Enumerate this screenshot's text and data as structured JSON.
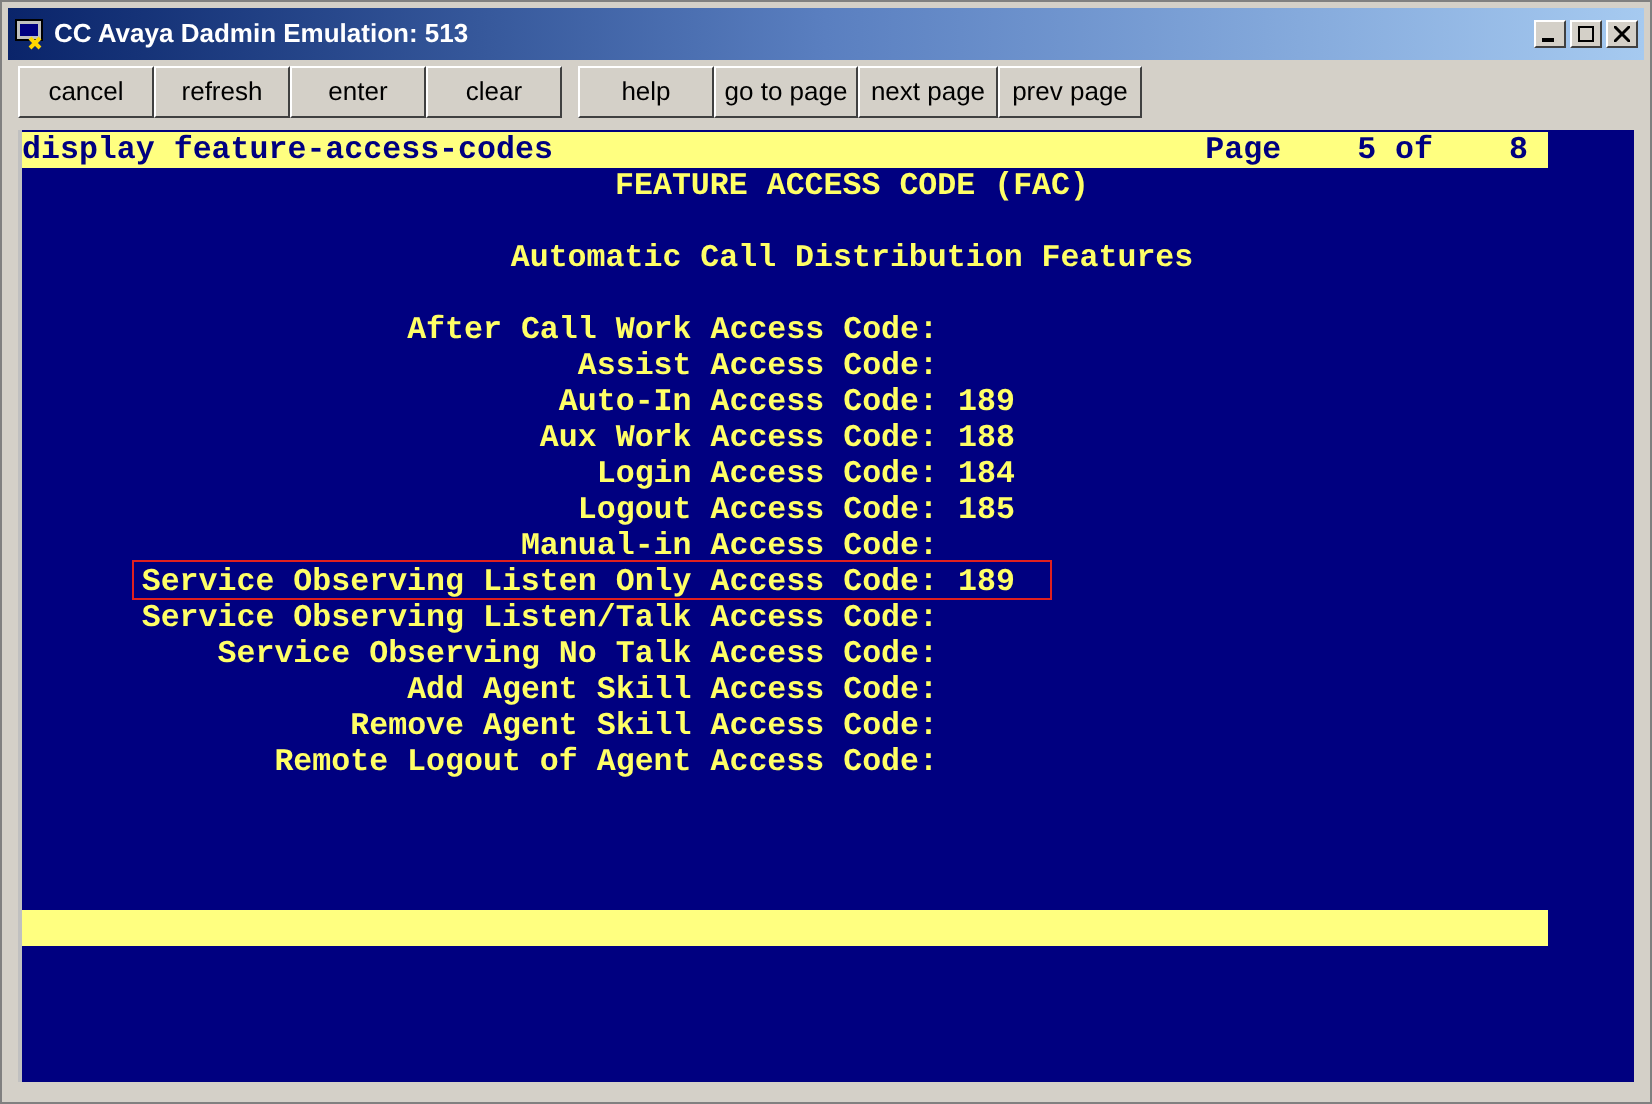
{
  "window": {
    "title": "CC Avaya Dadmin Emulation: 513"
  },
  "toolbar": [
    "cancel",
    "refresh",
    "enter",
    "clear",
    "help",
    "go to page",
    "next page",
    "prev page"
  ],
  "terminal": {
    "command": "display feature-access-codes",
    "page_label": "Page",
    "page": "5",
    "of_label": "of",
    "pages": "8",
    "title": "FEATURE ACCESS CODE (FAC)",
    "section": "Automatic Call Distribution Features",
    "fields": [
      {
        "label": "After Call Work Access Code:",
        "highlighted": false
      },
      {
        "label": "Assist Access Code:",
        "highlighted": false
      },
      {
        "label": "Auto-In Access Code:",
        "value": "189",
        "highlighted": false
      },
      {
        "label": "Aux Work Access Code:",
        "value": "188",
        "highlighted": false
      },
      {
        "label": "Login Access Code:",
        "value": "184",
        "highlighted": false
      },
      {
        "label": "Logout Access Code:",
        "value": "185",
        "highlighted": false
      },
      {
        "label": "Manual-in Access Code:",
        "highlighted": false
      },
      {
        "label": "Service Observing Listen Only Access Code:",
        "value": "189",
        "highlighted": true
      },
      {
        "label": "Service Observing Listen/Talk Access Code:",
        "highlighted": false
      },
      {
        "label": "Service Observing No Talk Access Code:",
        "highlighted": false
      },
      {
        "label": "Add Agent Skill Access Code:",
        "highlighted": false
      },
      {
        "label": "Remove Agent Skill Access Code:",
        "highlighted": false
      },
      {
        "label": "Remote Logout of Agent Access Code:",
        "highlighted": false
      }
    ]
  }
}
